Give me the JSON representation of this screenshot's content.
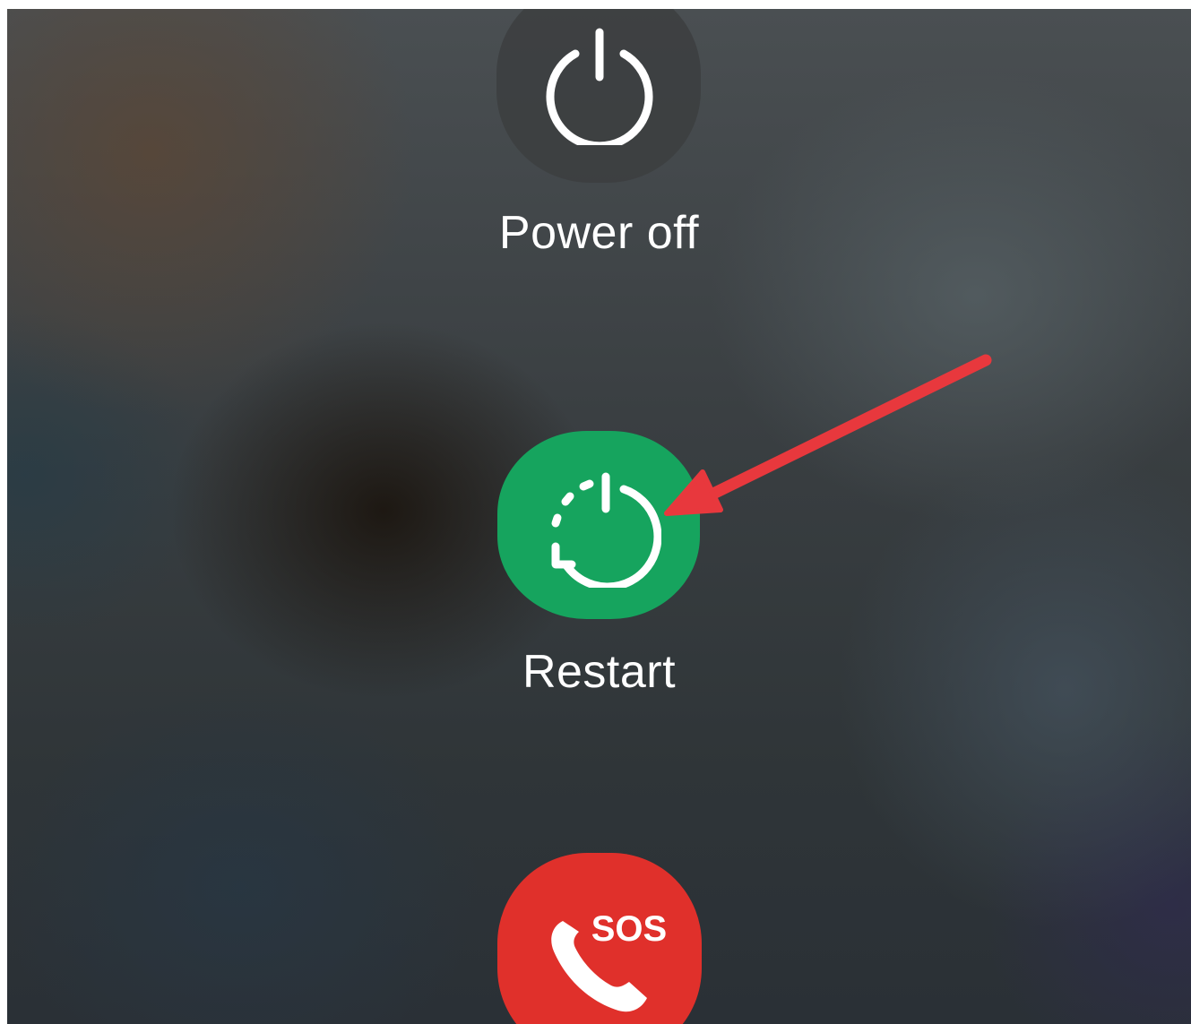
{
  "power_menu": {
    "power_off": {
      "label": "Power off",
      "icon": "power-icon"
    },
    "restart": {
      "label": "Restart",
      "icon": "restart-icon",
      "color": "#16a45e"
    },
    "emergency": {
      "badge": "SOS",
      "icon": "phone-sos-icon",
      "color": "#e0302b"
    }
  },
  "annotation": {
    "type": "arrow",
    "color": "#e8383d",
    "points_to": "restart"
  }
}
